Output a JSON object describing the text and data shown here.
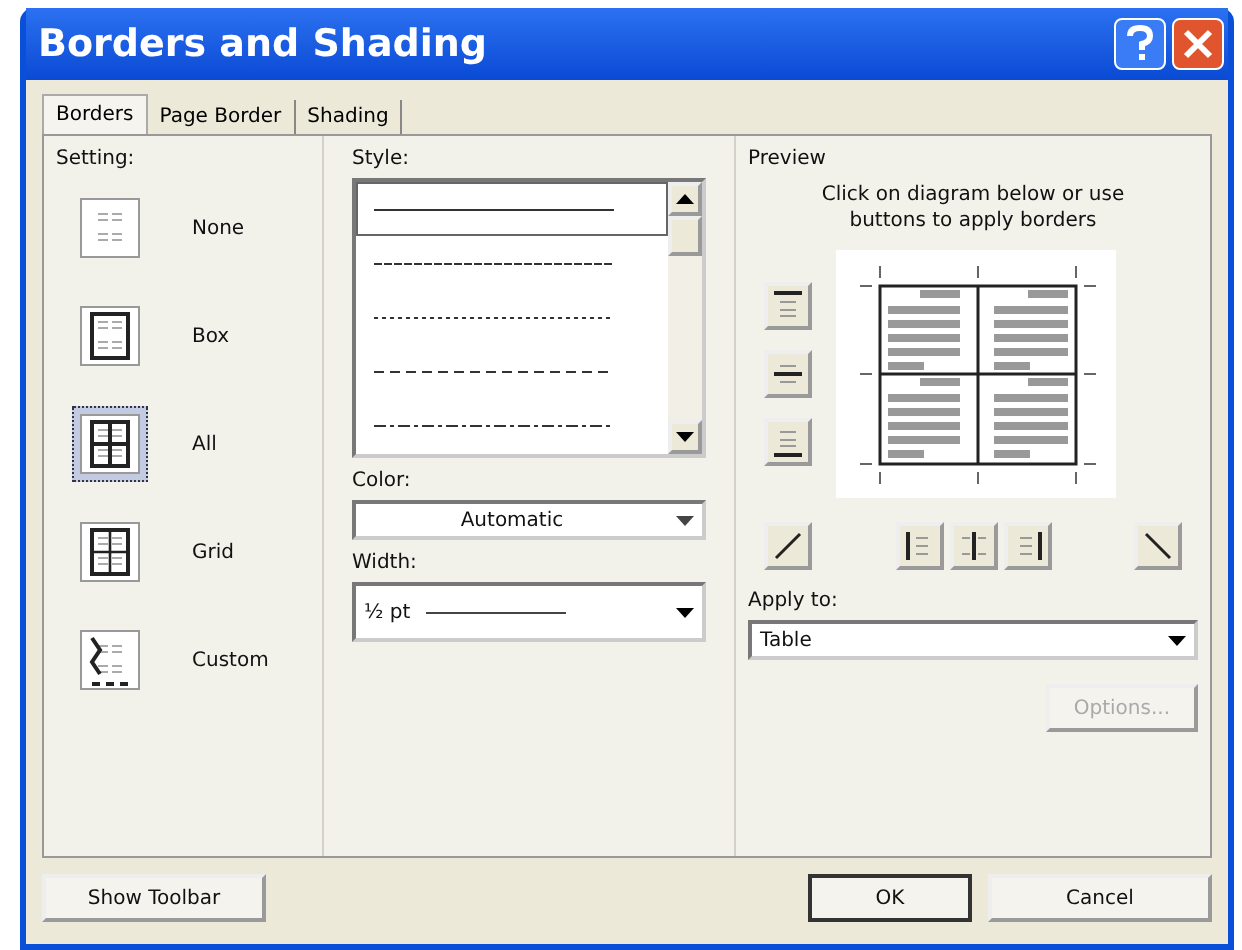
{
  "window": {
    "title": "Borders and Shading"
  },
  "tabs": [
    {
      "label": "Borders",
      "selected": true
    },
    {
      "label": "Page Border",
      "selected": false
    },
    {
      "label": "Shading",
      "selected": false
    }
  ],
  "setting": {
    "label": "Setting:",
    "items": [
      {
        "label": "None",
        "kind": "none",
        "selected": false
      },
      {
        "label": "Box",
        "kind": "box",
        "selected": false
      },
      {
        "label": "All",
        "kind": "all",
        "selected": true
      },
      {
        "label": "Grid",
        "kind": "grid",
        "selected": false
      },
      {
        "label": "Custom",
        "kind": "custom",
        "selected": false
      }
    ]
  },
  "style": {
    "label": "Style:",
    "items": [
      {
        "kind": "solid",
        "selected": true
      },
      {
        "kind": "dense",
        "selected": false
      },
      {
        "kind": "dotted",
        "selected": false
      },
      {
        "kind": "dashed",
        "selected": false
      },
      {
        "kind": "dashdot",
        "selected": false
      }
    ]
  },
  "color": {
    "label": "Color:",
    "value": "Automatic"
  },
  "width": {
    "label": "Width:",
    "value": "½ pt"
  },
  "preview": {
    "label": "Preview",
    "hint": "Click on diagram below or use buttons to apply borders"
  },
  "apply_to": {
    "label": "Apply to:",
    "value": "Table"
  },
  "options_button": {
    "label": "Options...",
    "disabled": true
  },
  "buttons": {
    "show_toolbar": "Show Toolbar",
    "ok": "OK",
    "cancel": "Cancel"
  }
}
